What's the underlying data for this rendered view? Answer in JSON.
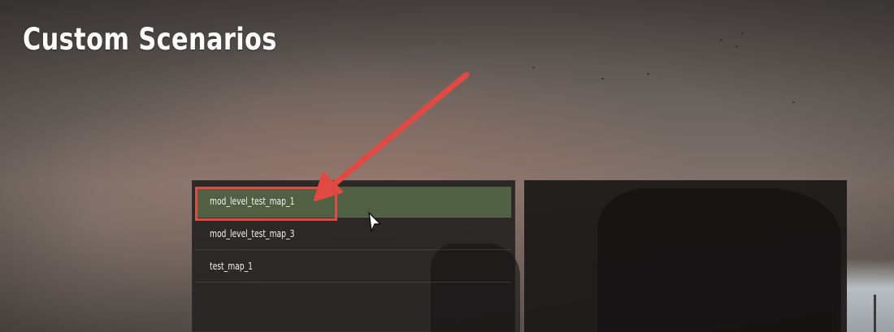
{
  "page": {
    "title": "Custom Scenarios"
  },
  "scenario_list": {
    "items": [
      {
        "label": "mod_level_test_map_1",
        "selected": true
      },
      {
        "label": "mod_level_test_map_3",
        "selected": false
      },
      {
        "label": "test_map_1",
        "selected": false
      }
    ]
  },
  "annotation": {
    "color": "#e04a42",
    "target": "mod_level_test_map_1"
  },
  "colors": {
    "selected_row": "#586a48",
    "panel": "#262322"
  }
}
